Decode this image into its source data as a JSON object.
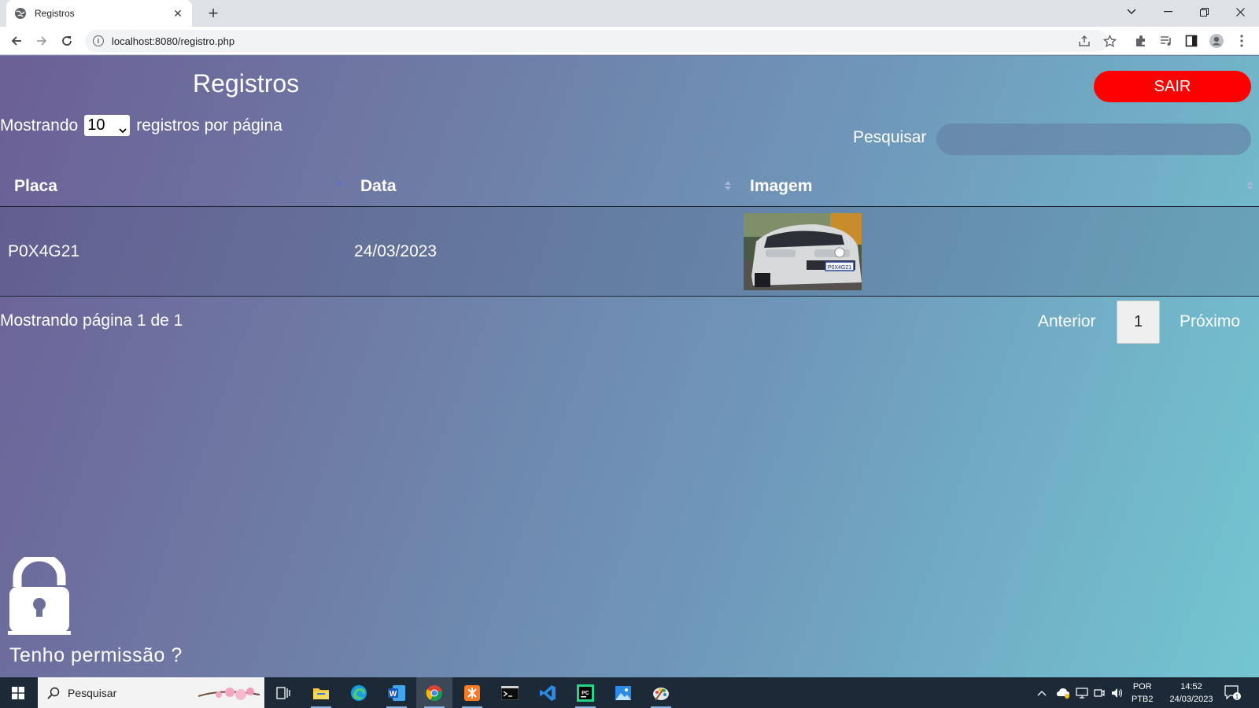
{
  "browser": {
    "tab_title": "Registros",
    "url": "localhost:8080/registro.php"
  },
  "page": {
    "title": "Registros",
    "logout_label": "SAIR",
    "length_prefix": "Mostrando",
    "length_value": "10",
    "length_suffix": "registros por página",
    "search_label": "Pesquisar",
    "search_value": ""
  },
  "table": {
    "columns": [
      "Placa",
      "Data",
      "Imagem"
    ],
    "rows": [
      {
        "placa": "P0X4G21",
        "data": "24/03/2023",
        "plate_on_image": "P0X4G21"
      }
    ]
  },
  "pagination": {
    "info": "Mostrando página 1 de 1",
    "previous": "Anterior",
    "current": "1",
    "next": "Próximo"
  },
  "footer": {
    "permission_text": "Tenho permissão ?"
  },
  "taskbar": {
    "search_placeholder": "Pesquisar",
    "language": "POR",
    "keyboard": "PTB2",
    "time": "14:52",
    "date": "24/03/2023",
    "notification_count": "1"
  },
  "colors": {
    "logout_button": "#ff0000",
    "gradient_start": "#6b5f96",
    "gradient_end": "#73c6d2"
  },
  "icons": [
    "globe-icon",
    "close-icon",
    "plus-icon",
    "back-icon",
    "forward-icon",
    "reload-icon",
    "info-icon",
    "share-icon",
    "star-icon",
    "puzzle-icon",
    "media-icon",
    "sidepanel-icon",
    "profile-icon",
    "menu-icon",
    "lock-open-icon",
    "windows-icon",
    "search-icon"
  ]
}
